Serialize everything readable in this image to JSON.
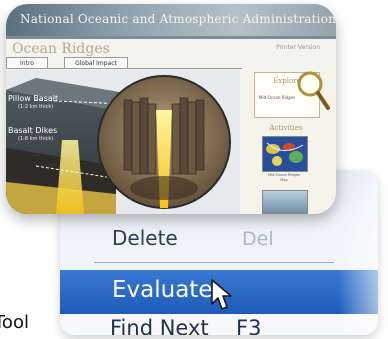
{
  "menu": {
    "delete_label": "Delete",
    "delete_shortcut": "Del",
    "evaluate_label": "Evaluate",
    "find_next_label": "Find Next",
    "find_next_shortcut": "F3",
    "highlight_color": "#2a68c4"
  },
  "caption": {
    "tool_text": "Tool"
  },
  "website": {
    "banner_title": "National Oceanic and Atmospheric Administration",
    "page_title": "Ocean Ridges",
    "top_link": "Printer Version",
    "tabs": [
      "Intro",
      "Global Impact"
    ],
    "diagram_labels": {
      "pillow_basalt": "Pillow Basalt",
      "pillow_basalt_thickness": "(1-2 km thick)",
      "basalt_dikes": "Basalt Dikes",
      "basalt_dikes_thickness": "(1-8 km thick)"
    },
    "sidebar": {
      "explore_title": "Explore",
      "explore_link": "Mid-Ocean Ridges",
      "activities_title": "Activities",
      "activity_caption": "Mid-Ocean Ridges Map"
    }
  }
}
